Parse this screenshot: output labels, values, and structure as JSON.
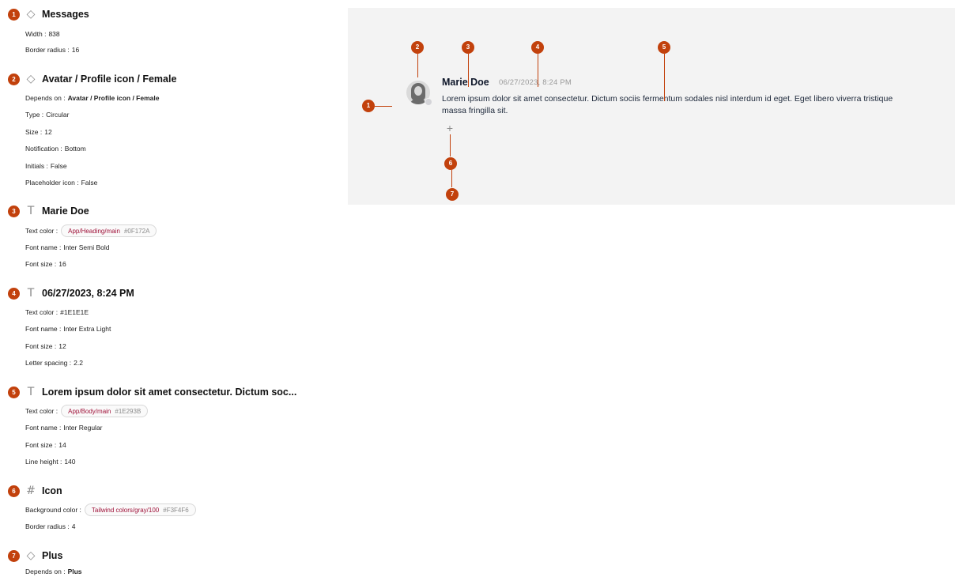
{
  "spec": {
    "sections": [
      {
        "num": "1",
        "glyph": "diamond-icon",
        "title": "Messages",
        "props": [
          {
            "label": "Width :",
            "value": "838"
          },
          {
            "label": "Border radius :",
            "value": "16"
          }
        ]
      },
      {
        "num": "2",
        "glyph": "diamond-icon",
        "title": "Avatar / Profile icon / Female",
        "props": [
          {
            "label": "Depends on :",
            "value": "Avatar / Profile icon / Female",
            "bold": true
          },
          {
            "label": "Type :",
            "value": "Circular"
          },
          {
            "label": "Size :",
            "value": "12"
          },
          {
            "label": "Notification :",
            "value": "Bottom"
          },
          {
            "label": "Initials :",
            "value": "False"
          },
          {
            "label": "Placeholder icon :",
            "value": "False"
          }
        ]
      },
      {
        "num": "3",
        "glyph": "text-icon",
        "title": "Marie Doe",
        "props": [
          {
            "label": "Text color :",
            "token": "App/Heading/main",
            "hex": "#0F172A"
          },
          {
            "label": "Font name :",
            "value": "Inter Semi Bold"
          },
          {
            "label": "Font size :",
            "value": "16"
          }
        ]
      },
      {
        "num": "4",
        "glyph": "text-icon",
        "title": "06/27/2023, 8:24 PM",
        "props": [
          {
            "label": "Text color :",
            "value": "#1E1E1E"
          },
          {
            "label": "Font name :",
            "value": "Inter Extra Light"
          },
          {
            "label": "Font size :",
            "value": "12"
          },
          {
            "label": "Letter spacing :",
            "value": "2.2"
          }
        ]
      },
      {
        "num": "5",
        "glyph": "text-icon",
        "title": "Lorem ipsum dolor sit amet consectetur. Dictum soc...",
        "props": [
          {
            "label": "Text color :",
            "token": "App/Body/main",
            "hex": "#1E293B"
          },
          {
            "label": "Font name :",
            "value": "Inter Regular"
          },
          {
            "label": "Font size :",
            "value": "14"
          },
          {
            "label": "Line height :",
            "value": "140"
          }
        ]
      },
      {
        "num": "6",
        "glyph": "frame-icon",
        "title": "Icon",
        "props": [
          {
            "label": "Background color :",
            "token": "Tailwind colors/gray/100",
            "hex": "#F3F4F6"
          },
          {
            "label": "Border radius :",
            "value": "4"
          }
        ]
      },
      {
        "num": "7",
        "glyph": "diamond-icon",
        "title": "Plus",
        "props": [
          {
            "label": "Depends on :",
            "value": "Plus",
            "bold": true
          }
        ]
      }
    ]
  },
  "preview": {
    "name": "Marie Doe",
    "time": "06/27/2023, 8:24 PM",
    "body": "Lorem ipsum dolor sit amet consectetur. Dictum sociis fermentum sodales nisl interdum id eget. Eget libero viverra tristique massa fringilla sit.",
    "plus": "+",
    "avatar": "avatar-female-icon",
    "pins": [
      "1",
      "2",
      "3",
      "4",
      "5",
      "6",
      "7"
    ]
  },
  "colors": {
    "accent": "#c2410c",
    "heading": "#0F172A",
    "body": "#1E293B",
    "token": "#9f1239",
    "panel_bg": "#f3f3f3"
  }
}
